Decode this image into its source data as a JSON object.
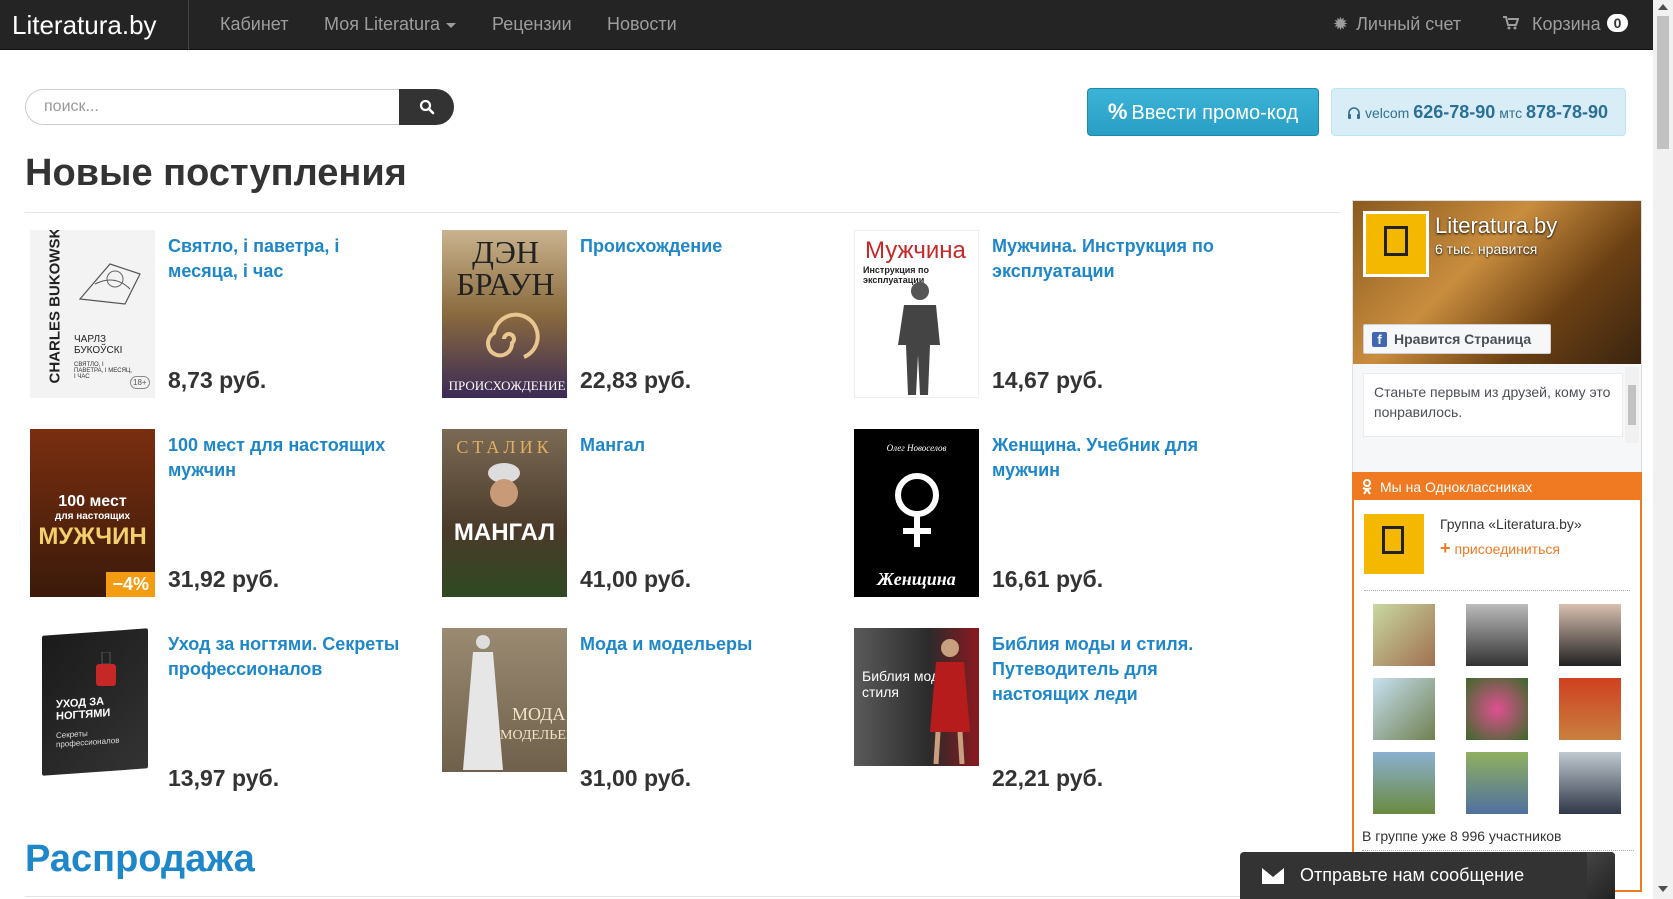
{
  "navbar": {
    "brand": "Literatura.by",
    "items": [
      {
        "label": "Кабинет"
      },
      {
        "label": "Моя Literatura"
      },
      {
        "label": "Рецензии"
      },
      {
        "label": "Новости"
      }
    ],
    "account_label": "Личный счет",
    "cart_label": "Корзина",
    "cart_count": "0"
  },
  "search": {
    "placeholder": "поиск..."
  },
  "promo": {
    "symbol": "%",
    "label": "Ввести промо-код"
  },
  "phones": {
    "op1": "velcom",
    "num1": "626-78-90",
    "op2": "мтс",
    "num2": "878-78-90"
  },
  "sections": {
    "new": "Новые поступления",
    "sale": "Распродажа"
  },
  "products": [
    {
      "title": "Святло, і паветра, і месяца, і час",
      "price": "8,73 руб.",
      "cover": {
        "top": "CHARLES BUKOWSKI",
        "author": "ЧАРЛЗ БУКОЎСКІ",
        "sub": "СВЯТЛО, І ПАВЕТРА, І МЕСЯЦ, І ЧАС",
        "age": "18+"
      }
    },
    {
      "title": "Происхождение",
      "price": "22,83 руб.",
      "cover": {
        "top": "ДЭН БРАУН",
        "bottom": "ПРОИСХОЖДЕНИЕ"
      }
    },
    {
      "title": "Мужчина. Инструкция по эксплуатации",
      "price": "14,67 руб.",
      "cover": {
        "top": "Мужчина",
        "sub": "Инструкция по эксплуатации"
      }
    },
    {
      "title": "100 мест для настоящих мужчин",
      "price": "31,92 руб.",
      "discount": "−4%",
      "cover": {
        "top": "100 мест",
        "mid": "для настоящих",
        "bottom": "МУЖЧИН"
      }
    },
    {
      "title": "Мангал",
      "price": "41,00 руб.",
      "cover": {
        "top": "СТАЛИК",
        "bottom": "МАНГАЛ"
      }
    },
    {
      "title": "Женщина. Учебник для мужчин",
      "price": "16,61 руб.",
      "cover": {
        "top": "Олег Новоселов",
        "bottom": "Женщина"
      }
    },
    {
      "title": "Уход за ногтями. Секреты профессионалов",
      "price": "13,97 руб.",
      "cover": {
        "top": "УХОД ЗА НОГТЯМИ",
        "sub": "Секреты профессионалов"
      }
    },
    {
      "title": "Мода и модельеры",
      "price": "31,00 руб.",
      "cover": {
        "top": "МОДА",
        "bottom": "МОДЕЛЬЕРЫ"
      }
    },
    {
      "title": "Библия моды и стиля. Путеводитель для настоящих леди",
      "price": "22,21 руб.",
      "cover": {
        "top": "Библия моды и стиля"
      }
    }
  ],
  "facebook": {
    "name": "Literatura.by",
    "likes": "6 тыс. нравится",
    "like_button": "Нравится Страница",
    "friends_text": "Станьте первым из друзей, кому это понравилось."
  },
  "ok": {
    "header": "Мы на Одноклассниках",
    "group": "Группа «Literatura.by»",
    "join": "присоединиться",
    "members": "В группе уже 8 996 участников"
  },
  "message_bar": {
    "label": "Отправьте нам сообщение"
  },
  "colors": {
    "link": "#1e87c9",
    "navbar": "#242424",
    "promo": "#2a9fc6",
    "ok": "#f07a22",
    "discount": "#f39c12"
  }
}
